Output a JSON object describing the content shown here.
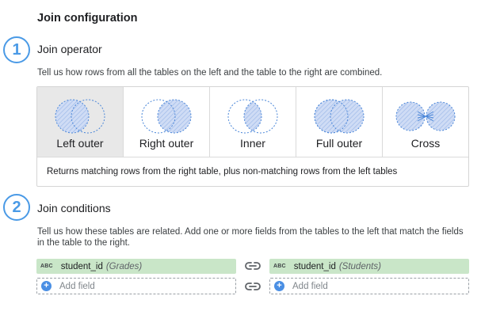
{
  "heading": "Join configuration",
  "steps": [
    {
      "number": "1",
      "title": "Join operator",
      "description": "Tell us how rows from all the tables on the left and the table to the right are combined."
    },
    {
      "number": "2",
      "title": "Join conditions",
      "description": "Tell us how these tables are related. Add one or more fields from the tables to the left that match the fields in the table to the right."
    }
  ],
  "join_options": [
    {
      "label": "Left outer",
      "icon": "left-outer-venn-icon",
      "selected": true
    },
    {
      "label": "Right outer",
      "icon": "right-outer-venn-icon",
      "selected": false
    },
    {
      "label": "Inner",
      "icon": "inner-venn-icon",
      "selected": false
    },
    {
      "label": "Full outer",
      "icon": "full-outer-venn-icon",
      "selected": false
    },
    {
      "label": "Cross",
      "icon": "cross-join-icon",
      "selected": false
    }
  ],
  "join_description": "Returns matching rows from the right table, plus non-matching rows from the left tables",
  "conditions": {
    "left": {
      "type_badge": "ABC",
      "field": "student_id",
      "source": "(Grades)",
      "add_label": "Add field"
    },
    "right": {
      "type_badge": "ABC",
      "field": "student_id",
      "source": "(Students)",
      "add_label": "Add field"
    },
    "link_icon": "link-icon"
  },
  "colors": {
    "accent": "#4a9ae6",
    "venn_fill": "#c6d9f5",
    "venn_stroke": "#4a86d8",
    "chip": "#c9e6c8",
    "selected_bg": "#e8e8e8"
  }
}
